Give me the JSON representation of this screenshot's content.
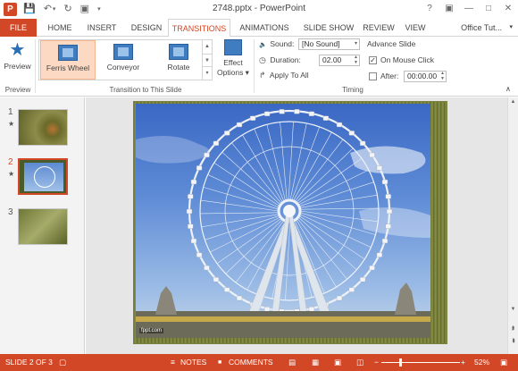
{
  "window": {
    "title": "2748.pptx - PowerPoint",
    "app_icon": "P",
    "controls": [
      "?",
      "▣",
      "—",
      "□",
      "✕"
    ]
  },
  "qat": {
    "save": "💾",
    "undo": "↶",
    "undo_arrow": "▾",
    "redo": "↻",
    "present": "▣",
    "customize": "▾"
  },
  "tabs": {
    "file": "FILE",
    "items": [
      "HOME",
      "INSERT",
      "DESIGN",
      "TRANSITIONS",
      "ANIMATIONS",
      "SLIDE SHOW",
      "REVIEW",
      "VIEW"
    ],
    "active": "TRANSITIONS",
    "account": "Office Tut...",
    "account_arrow": "▾"
  },
  "ribbon": {
    "preview": {
      "label": "Preview",
      "icon": "★",
      "group": "Preview"
    },
    "transitions_group": "Transition to This Slide",
    "gallery": [
      {
        "label": "Ferris Wheel",
        "selected": true
      },
      {
        "label": "Conveyor",
        "selected": false
      },
      {
        "label": "Rotate",
        "selected": false
      }
    ],
    "gallery_scroll": [
      "▲",
      "▼",
      "▾"
    ],
    "effect_options": {
      "line1": "Effect",
      "line2": "Options ▾"
    },
    "timing": {
      "group": "Timing",
      "sound_label": "Sound:",
      "sound_value": "[No Sound]",
      "duration_label": "Duration:",
      "duration_value": "02.00",
      "apply_all": "Apply To All",
      "advance_title": "Advance Slide",
      "on_mouse_click": "On Mouse Click",
      "on_mouse_click_checked": true,
      "after_label": "After:",
      "after_checked": false,
      "after_value": "00:00.00",
      "check_mark": "✓",
      "spin": [
        "▲",
        "▼"
      ],
      "dd": "▾",
      "sound_icon": "🔈",
      "duration_icon": "◷",
      "apply_icon": "↱"
    },
    "collapse": "∧"
  },
  "slides": [
    {
      "num": "1",
      "star": "★"
    },
    {
      "num": "2",
      "star": "★"
    },
    {
      "num": "3",
      "star": ""
    }
  ],
  "editor": {
    "watermark": "fppt.com"
  },
  "scrollbar": {
    "up": "▲",
    "down": "▼",
    "prev": "⮭",
    "next": "⮯"
  },
  "status": {
    "slide_info": "SLIDE 2 OF 3",
    "notes": "NOTES",
    "comments": "COMMENTS",
    "zoom": "52%",
    "minus": "−",
    "plus": "+",
    "notes_icon": "≡",
    "comments_icon": "■",
    "spell_icon": "▢"
  },
  "accent": "#d24726",
  "zoom_level": 0.52
}
